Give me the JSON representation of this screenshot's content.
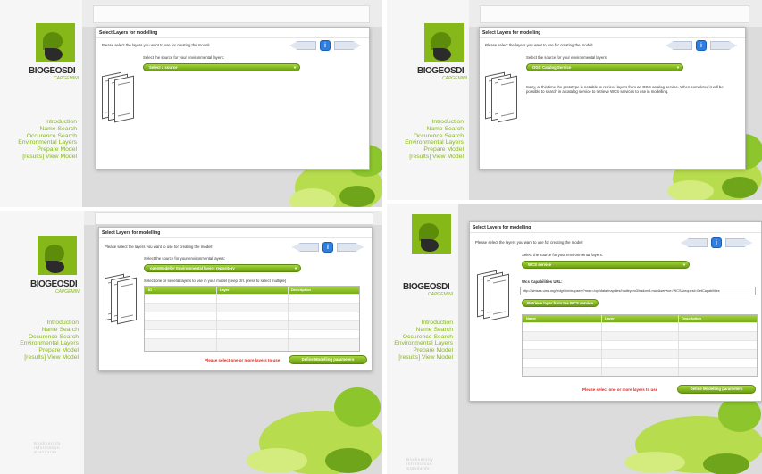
{
  "app": {
    "brand": "BIOGEOSDI",
    "brand_sub": "CAPGEMINI",
    "footer_brand": [
      "Biodiversity",
      "Information",
      "Standards"
    ],
    "nav": [
      "Introduction",
      "Name Search",
      "Occurence Search",
      "Environmental Layers",
      "Prepare Model",
      "[results] View Model"
    ]
  },
  "dialog": {
    "title": "Select Layers for modelling",
    "intro": "Please select the layers you want to use for creating the model!",
    "source_prompt": "Select the source for your environmental layers:",
    "pagination_current": "i"
  },
  "panels": [
    {
      "source": "Select a source"
    },
    {
      "source": "OGC Catalog Service",
      "message": "Sorry, at this time the prototype is not able to retrieve layers from an OGC catalog service. When completed it will be possible to search in a catalog service to retrieve WCS services to use in modelling."
    },
    {
      "source": "openModeller Environmental layers repository",
      "instruction": "Select one or several layers to use in your model (keep ctrl. press to select multiple)",
      "columns": [
        "ID",
        "Layer",
        "Description"
      ],
      "error": "Please select one or more layers to use",
      "action": "Define Modelling parameters"
    },
    {
      "source": "WCS service",
      "wcs_label": "Wcs Capabilities URL:",
      "wcs_url": "http://aimsas.uma.org/bnlgr/bin/mapserv?map=/opt/data/mapfiles/hadleycm3/hadcm3.map&service=WCS&request=GetCapabilities",
      "retrieve": "Retrieve layer from the WCS service",
      "columns": [
        "Name",
        "Layer",
        "Description"
      ],
      "error": "Please select one or more layers to use",
      "action": "Define Modelling parameters"
    }
  ],
  "colors": {
    "accent": "#86b81a",
    "error": "#e0231b",
    "pager": "#2f7fe0"
  }
}
